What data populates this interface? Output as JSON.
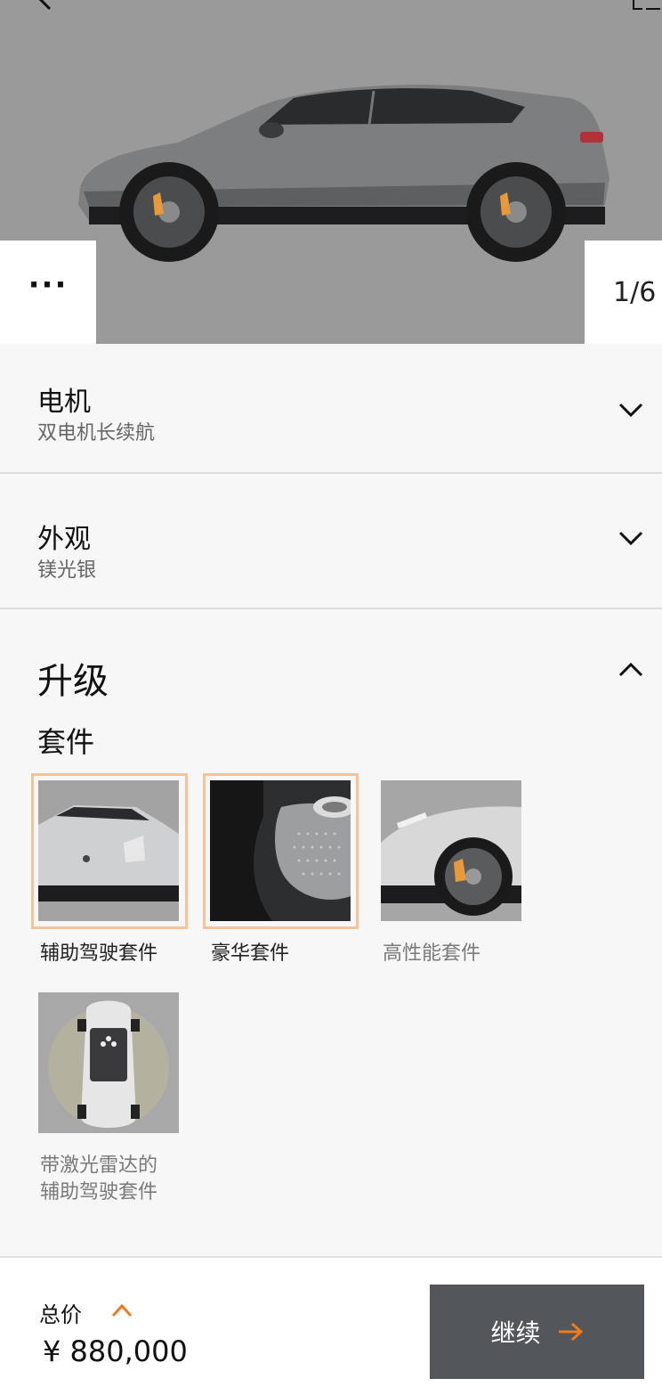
{
  "gallery": {
    "counter": "1/6",
    "more_label": "···"
  },
  "sections": {
    "motor": {
      "title": "电机",
      "value": "双电机长续航"
    },
    "exterior": {
      "title": "外观",
      "value": "镁光银"
    },
    "upgrade": {
      "title": "升级",
      "subtitle": "套件",
      "options": [
        {
          "label": "辅助驾驶套件",
          "selected": true
        },
        {
          "label": "豪华套件",
          "selected": true
        },
        {
          "label": "高性能套件",
          "selected": false
        },
        {
          "label": "带激光雷达的\n辅助驾驶套件",
          "selected": false
        }
      ]
    }
  },
  "footer": {
    "total_label": "总价",
    "price": "¥ 880,000",
    "continue_label": "继续"
  },
  "colors": {
    "accent": "#f07a1e",
    "selection_ring": "#f5c29b",
    "button_bg": "#53565a"
  }
}
